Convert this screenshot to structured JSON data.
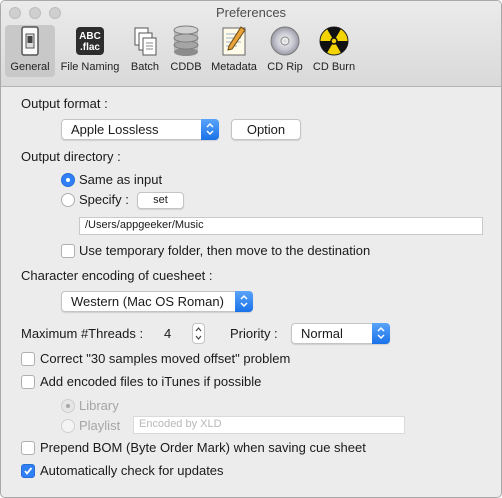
{
  "window": {
    "title": "Preferences"
  },
  "toolbar": {
    "items": [
      {
        "label": "General",
        "icon": "switch-icon"
      },
      {
        "label": "File Naming",
        "icon": "abc-flac-icon"
      },
      {
        "label": "Batch",
        "icon": "documents-icon"
      },
      {
        "label": "CDDB",
        "icon": "database-icon"
      },
      {
        "label": "Metadata",
        "icon": "edit-pencil-icon"
      },
      {
        "label": "CD Rip",
        "icon": "cd-icon"
      },
      {
        "label": "CD Burn",
        "icon": "radiation-icon"
      }
    ],
    "abc_line1": "ABC",
    "abc_line2": ".flac"
  },
  "output_format": {
    "label": "Output format :",
    "selected": "Apple Lossless",
    "option_button": "Option"
  },
  "output_directory": {
    "label": "Output directory :",
    "same_as_input": "Same as input",
    "specify": "Specify :",
    "set_button": "set",
    "path": "/Users/appgeeker/Music",
    "temp_folder": "Use temporary folder, then move to the destination"
  },
  "cuesheet": {
    "label": "Character encoding of cuesheet :",
    "selected": "Western (Mac OS Roman)"
  },
  "threads": {
    "label": "Maximum #Threads :",
    "value": "4",
    "priority_label": "Priority :",
    "priority_selected": "Normal"
  },
  "options": {
    "correct_offset": "Correct \"30 samples moved offset\" problem",
    "add_itunes": "Add encoded files to iTunes if possible",
    "library": "Library",
    "playlist": "Playlist",
    "playlist_placeholder": "Encoded by XLD",
    "prepend_bom": "Prepend BOM (Byte Order Mark) when saving cue sheet",
    "auto_update": "Automatically check for updates"
  },
  "colors": {
    "accent": "#2f7ff5",
    "burn_yellow": "#f3d400"
  }
}
